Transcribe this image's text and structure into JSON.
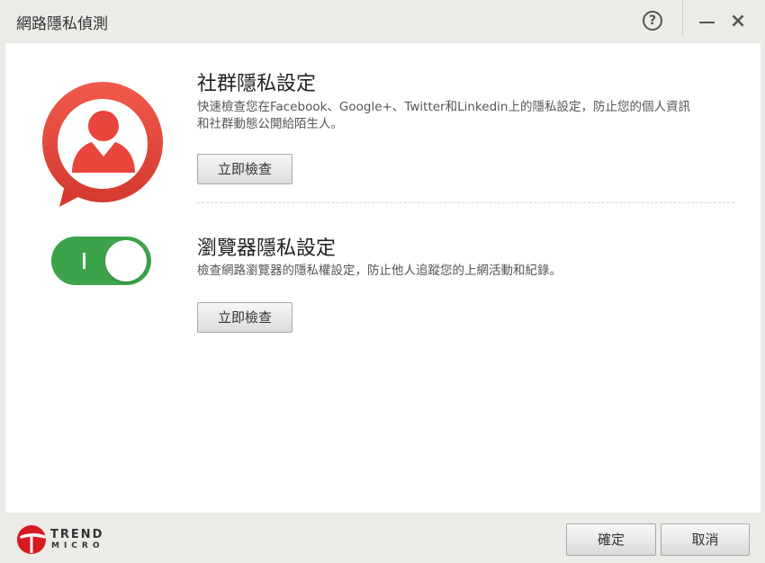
{
  "window": {
    "title": "網路隱私偵測",
    "help_glyph": "?",
    "minimize_glyph": "—",
    "close_glyph": "×"
  },
  "social": {
    "title": "社群隱私設定",
    "description_line1": "快速檢查您在Facebook、Google+、Twitter和Linkedin上的隱私設定，防止您的個人資訊",
    "description_line2": "和社群動態公開給陌生人。",
    "button_label": "立即檢查",
    "icon_color": "#e8453c"
  },
  "browser": {
    "title": "瀏覽器隱私設定",
    "description": "檢查網路瀏覽器的隱私權設定，防止他人追蹤您的上網活動和紀錄。",
    "button_label": "立即檢查",
    "toggle_state": "on",
    "toggle_color": "#3da34a"
  },
  "footer": {
    "brand_name": "TREND",
    "brand_sub": "MICRO",
    "ok_label": "確定",
    "cancel_label": "取消"
  }
}
